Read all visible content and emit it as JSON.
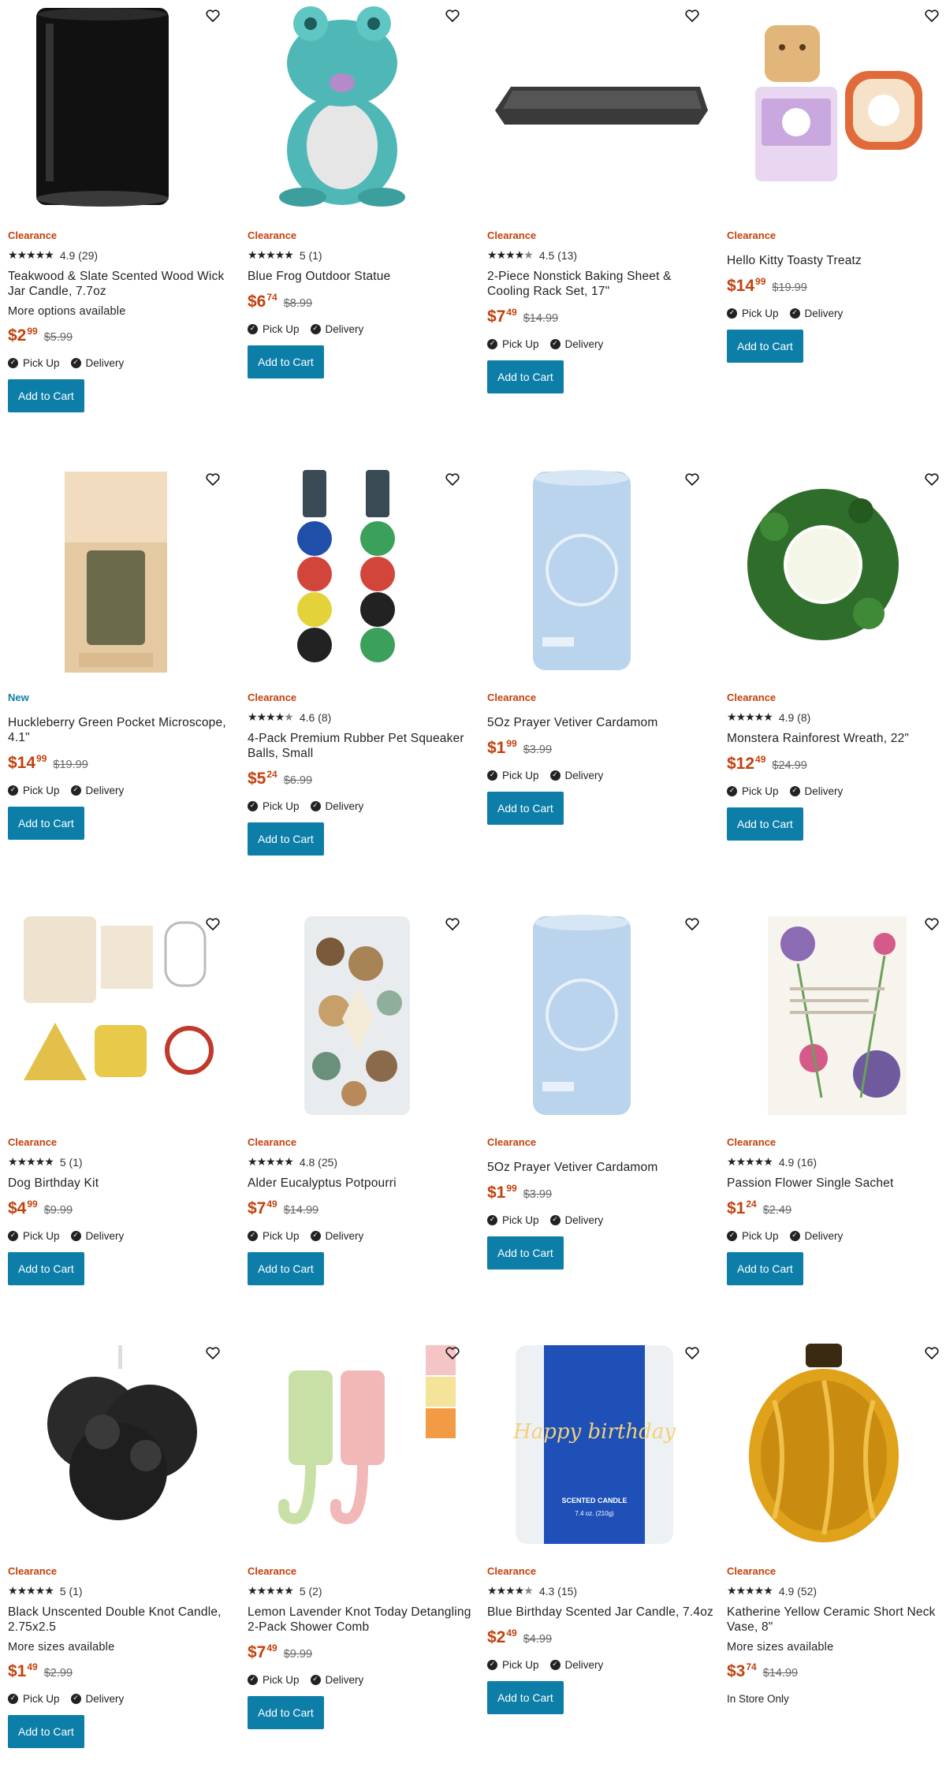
{
  "labels": {
    "add_to_cart": "Add to Cart",
    "pick_up": "Pick Up",
    "delivery": "Delivery"
  },
  "colors": {
    "clearance": "#c2410c",
    "new": "#0f7ea6",
    "button": "#0c7ea8"
  },
  "products": [
    {
      "tag": "Clearance",
      "stars": 5,
      "rating": "4.9 (29)",
      "name": "Teakwood & Slate Scented Wood Wick Jar Candle, 7.7oz",
      "options": "More options available",
      "price_d": "$2",
      "price_c": "99",
      "orig": "$5.99",
      "pickup": true,
      "delivery": true,
      "cart": true,
      "icon": "black-candle-jar"
    },
    {
      "tag": "Clearance",
      "stars": 5,
      "rating": "5 (1)",
      "name": "Blue Frog Outdoor Statue",
      "options": "",
      "price_d": "$6",
      "price_c": "74",
      "orig": "$8.99",
      "pickup": true,
      "delivery": true,
      "cart": true,
      "icon": "blue-frog-statue"
    },
    {
      "tag": "Clearance",
      "stars": 4.5,
      "rating": "4.5 (13)",
      "name": "2-Piece Nonstick Baking Sheet & Cooling Rack Set, 17\"",
      "options": "",
      "price_d": "$7",
      "price_c": "49",
      "orig": "$14.99",
      "pickup": true,
      "delivery": true,
      "cart": true,
      "icon": "baking-sheet"
    },
    {
      "tag": "Clearance",
      "stars": 0,
      "rating": "",
      "name": "Hello Kitty Toasty Treatz",
      "options": "",
      "price_d": "$14",
      "price_c": "99",
      "orig": "$19.99",
      "pickup": true,
      "delivery": true,
      "cart": true,
      "icon": "hello-kitty-toaster"
    },
    {
      "tag": "New",
      "stars": 0,
      "rating": "",
      "name": "Huckleberry Green Pocket Microscope, 4.1\"",
      "options": "",
      "price_d": "$14",
      "price_c": "99",
      "orig": "$19.99",
      "pickup": true,
      "delivery": true,
      "cart": true,
      "icon": "pocket-microscope-box"
    },
    {
      "tag": "Clearance",
      "stars": 4.5,
      "rating": "4.6 (8)",
      "name": "4-Pack Premium Rubber Pet Squeaker Balls, Small",
      "options": "",
      "price_d": "$5",
      "price_c": "24",
      "orig": "$6.99",
      "pickup": true,
      "delivery": true,
      "cart": true,
      "icon": "pet-balls"
    },
    {
      "tag": "Clearance",
      "stars": 0,
      "rating": "",
      "name": "5Oz Prayer Vetiver Cardamom",
      "options": "",
      "price_d": "$1",
      "price_c": "99",
      "orig": "$3.99",
      "pickup": true,
      "delivery": true,
      "cart": true,
      "icon": "blue-candle"
    },
    {
      "tag": "Clearance",
      "stars": 5,
      "rating": "4.9 (8)",
      "name": "Monstera Rainforest Wreath, 22\"",
      "options": "",
      "price_d": "$12",
      "price_c": "49",
      "orig": "$24.99",
      "pickup": true,
      "delivery": true,
      "cart": true,
      "icon": "wreath"
    },
    {
      "tag": "Clearance",
      "stars": 5,
      "rating": "5 (1)",
      "name": "Dog Birthday Kit",
      "options": "",
      "price_d": "$4",
      "price_c": "99",
      "orig": "$9.99",
      "pickup": true,
      "delivery": true,
      "cart": true,
      "icon": "dog-birthday-kit"
    },
    {
      "tag": "Clearance",
      "stars": 5,
      "rating": "4.8 (25)",
      "name": "Alder Eucalyptus Potpourri",
      "options": "",
      "price_d": "$7",
      "price_c": "49",
      "orig": "$14.99",
      "pickup": true,
      "delivery": true,
      "cart": true,
      "icon": "potpourri-jar"
    },
    {
      "tag": "Clearance",
      "stars": 0,
      "rating": "",
      "name": "5Oz Prayer Vetiver Cardamom",
      "options": "",
      "price_d": "$1",
      "price_c": "99",
      "orig": "$3.99",
      "pickup": true,
      "delivery": true,
      "cart": true,
      "icon": "blue-candle"
    },
    {
      "tag": "Clearance",
      "stars": 5,
      "rating": "4.9 (16)",
      "name": "Passion Flower Single Sachet",
      "options": "",
      "price_d": "$1",
      "price_c": "24",
      "orig": "$2.49",
      "pickup": true,
      "delivery": true,
      "cart": true,
      "icon": "flower-sachet"
    },
    {
      "tag": "Clearance",
      "stars": 5,
      "rating": "5 (1)",
      "name": "Black Unscented Double Knot Candle, 2.75x2.5",
      "options": "More sizes available",
      "price_d": "$1",
      "price_c": "49",
      "orig": "$2.99",
      "pickup": true,
      "delivery": true,
      "cart": true,
      "icon": "knot-candle"
    },
    {
      "tag": "Clearance",
      "stars": 5,
      "rating": "5 (2)",
      "name": "Lemon Lavender Knot Today Detangling 2-Pack Shower Comb",
      "options": "",
      "price_d": "$7",
      "price_c": "49",
      "orig": "$9.99",
      "pickup": true,
      "delivery": true,
      "cart": true,
      "icon": "shower-combs"
    },
    {
      "tag": "Clearance",
      "stars": 4.5,
      "rating": "4.3 (15)",
      "name": "Blue Birthday Scented Jar Candle, 7.4oz",
      "options": "",
      "price_d": "$2",
      "price_c": "49",
      "orig": "$4.99",
      "pickup": true,
      "delivery": true,
      "cart": true,
      "icon": "birthday-candle",
      "birthday_text": "Happy birthday",
      "candle_label": "SCENTED CANDLE",
      "candle_weight": "7.4 oz. (210g)"
    },
    {
      "tag": "Clearance",
      "stars": 5,
      "rating": "4.9 (52)",
      "name": "Katherine Yellow Ceramic Short Neck Vase, 8\"",
      "options": "More sizes available",
      "price_d": "$3",
      "price_c": "74",
      "orig": "$14.99",
      "pickup": false,
      "delivery": false,
      "cart": false,
      "instore": "In Store Only",
      "icon": "yellow-vase"
    }
  ]
}
